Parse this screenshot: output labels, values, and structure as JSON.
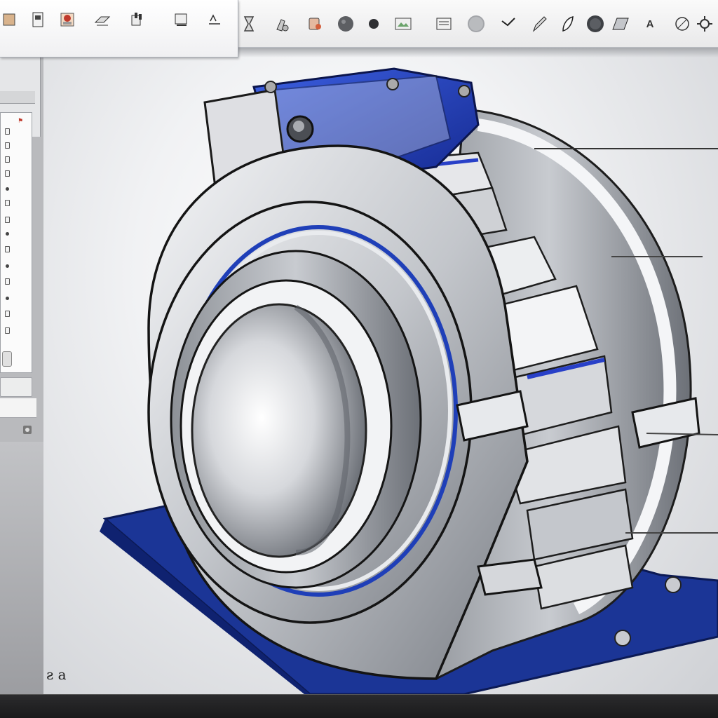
{
  "ribbon": {
    "buttons": [
      {
        "name": "ribbon-button-1",
        "label": "",
        "icon": "part-icon"
      },
      {
        "name": "ribbon-button-2",
        "label": "",
        "icon": "document-icon"
      },
      {
        "name": "ribbon-button-3",
        "label": "",
        "icon": "assembly-icon"
      },
      {
        "name": "ribbon-button-4",
        "label": "",
        "icon": "extrude-icon"
      },
      {
        "name": "ribbon-button-5",
        "label": "",
        "icon": "revolve-icon"
      },
      {
        "name": "ribbon-button-6",
        "label": "",
        "icon": "sweep-icon"
      },
      {
        "name": "ribbon-button-7",
        "label": "",
        "icon": "loft-icon"
      }
    ],
    "strip_text": ""
  },
  "toolbar": {
    "tools": [
      {
        "name": "hourglass-tool",
        "icon": "hourglass-icon"
      },
      {
        "name": "paint-tool",
        "icon": "paint-icon"
      },
      {
        "name": "sphere-tool",
        "icon": "sphere-icon"
      },
      {
        "name": "shade-tool",
        "icon": "shade-icon"
      },
      {
        "name": "render-tool",
        "icon": "render-icon"
      },
      {
        "name": "sheet-tool",
        "icon": "sheet-icon"
      },
      {
        "name": "sphere-light-tool",
        "icon": "sphere-light-icon"
      },
      {
        "name": "arrow-tool",
        "icon": "arrow-icon"
      },
      {
        "name": "pen-tool",
        "icon": "pen-icon"
      },
      {
        "name": "leaf-tool",
        "icon": "leaf-icon"
      },
      {
        "name": "dark-sphere-tool",
        "icon": "dark-sphere-icon"
      },
      {
        "name": "panel-tool",
        "icon": "panel-icon"
      },
      {
        "name": "text-tool",
        "icon": "text-icon"
      },
      {
        "name": "circle-tool",
        "icon": "circle-icon"
      },
      {
        "name": "gear-tool",
        "icon": "gear-icon"
      }
    ],
    "text_tool_label": "A"
  },
  "viewport": {
    "triad_label": "ƨ a"
  },
  "status": {
    "text": ""
  },
  "colors": {
    "accent_blue": "#1f3fb8",
    "base_plate": "#1b3596",
    "metal": "#c9cbd0"
  }
}
